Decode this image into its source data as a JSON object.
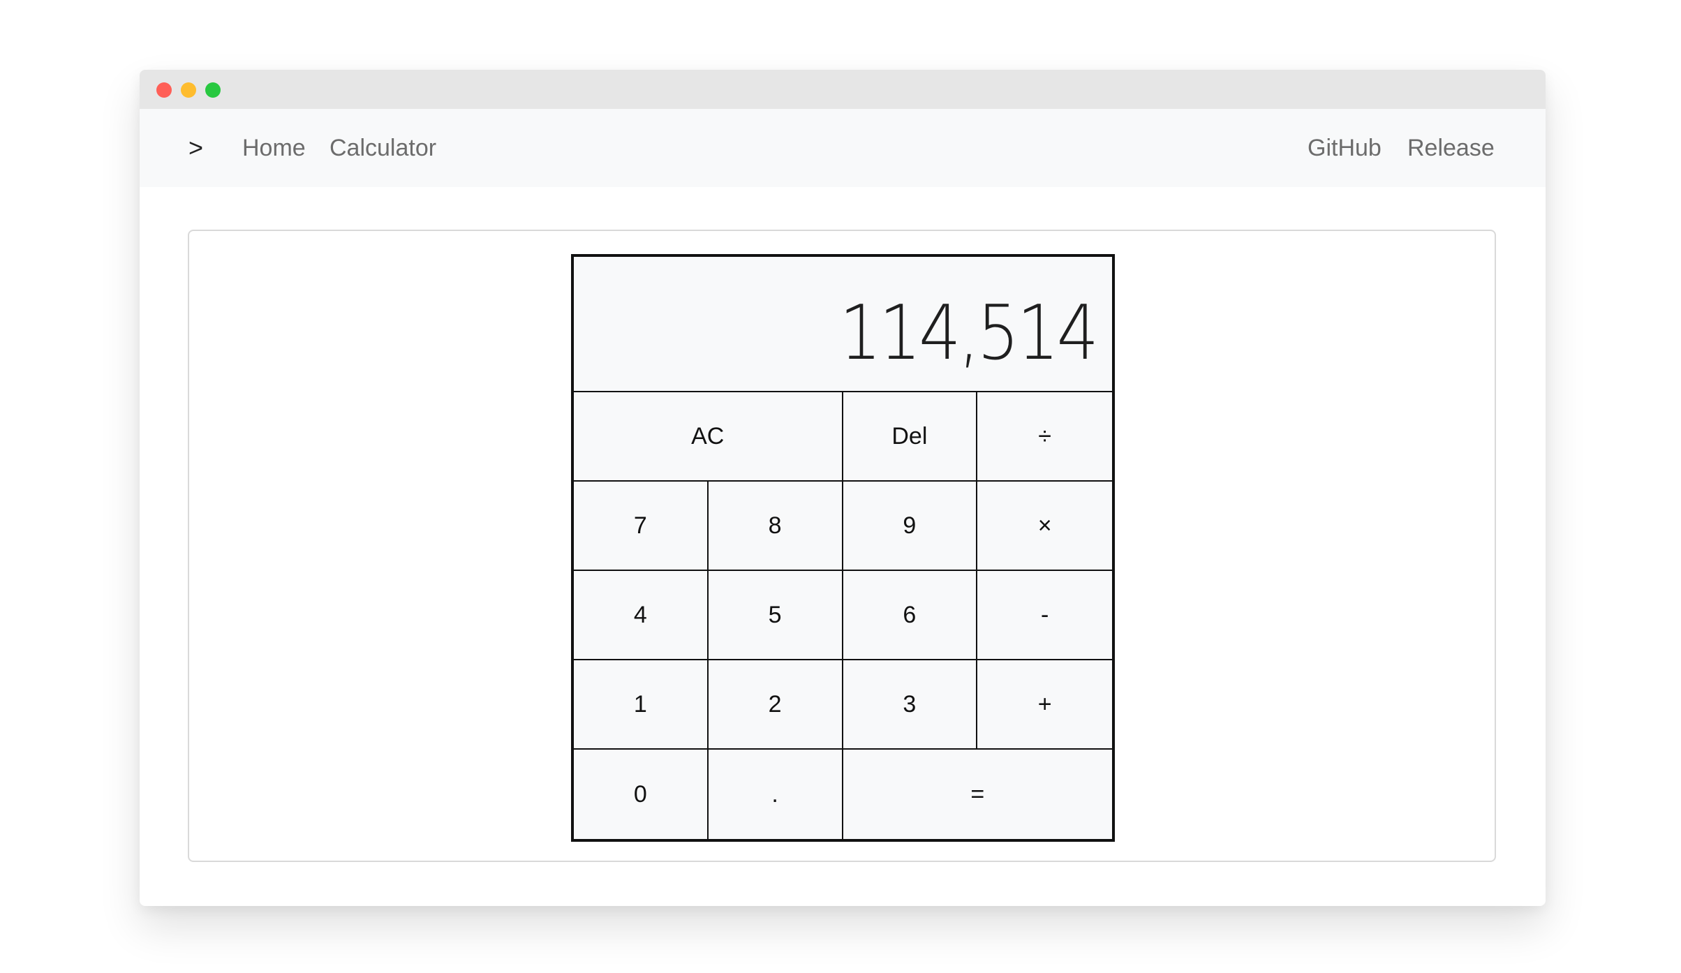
{
  "window": {
    "controls": [
      "close",
      "minimize",
      "maximize"
    ]
  },
  "navbar": {
    "brand": ">",
    "left_links": [
      "Home",
      "Calculator"
    ],
    "right_links": [
      "GitHub",
      "Release"
    ]
  },
  "calculator": {
    "display": "114,514",
    "keys": {
      "ac": "AC",
      "del": "Del",
      "divide": "÷",
      "seven": "7",
      "eight": "8",
      "nine": "9",
      "multiply": "×",
      "four": "4",
      "five": "5",
      "six": "6",
      "minus": "-",
      "one": "1",
      "two": "2",
      "three": "3",
      "plus": "+",
      "zero": "0",
      "decimal": ".",
      "equals": "="
    }
  }
}
